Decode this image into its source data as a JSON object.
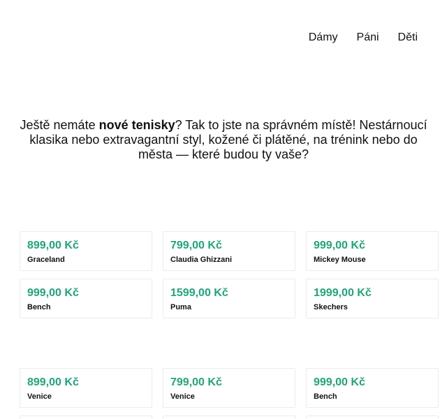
{
  "nav": {
    "items": [
      "Dámy",
      "Páni",
      "Děti"
    ]
  },
  "intro": {
    "part1": "Ještě nemáte ",
    "bold": "nové tenisky",
    "part2": "? Tak to jste na správném místě! Nestárnoucí klasika nebo extravagantní styl, kožené či plátěné, na trénink nebo do města — které budou ty vaše?"
  },
  "products_group1": [
    {
      "price": "899,00 Kč",
      "brand": "Graceland"
    },
    {
      "price": "799,00 Kč",
      "brand": "Claudia Ghizzani"
    },
    {
      "price": "999,00 Kč",
      "brand": "Mickey Mouse"
    },
    {
      "price": "999,00 Kč",
      "brand": "Bench"
    },
    {
      "price": "1599,00 Kč",
      "brand": "Puma"
    },
    {
      "price": "1999,00 Kč",
      "brand": "Skechers"
    }
  ],
  "products_group2": [
    {
      "price": "899,00 Kč",
      "brand": "Venice"
    },
    {
      "price": "799,00 Kč",
      "brand": "Venice"
    },
    {
      "price": "999,00 Kč",
      "brand": "Bench"
    }
  ],
  "colors": {
    "price": "#21a47a"
  }
}
